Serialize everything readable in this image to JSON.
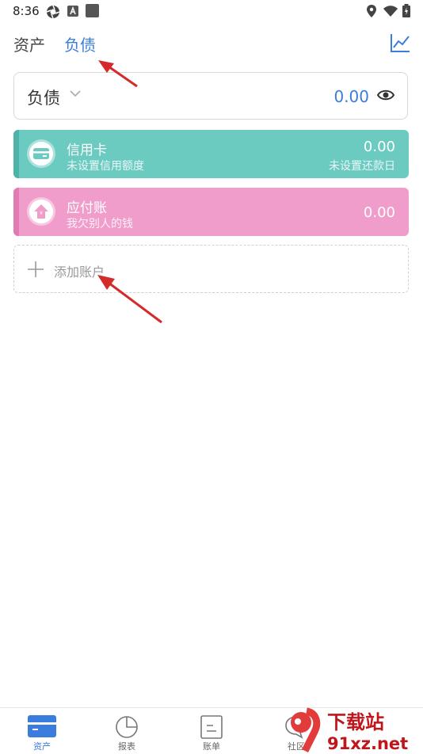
{
  "status_bar": {
    "time": "8:36"
  },
  "tabs": [
    {
      "label": "资产",
      "active": false
    },
    {
      "label": "负债",
      "active": true
    }
  ],
  "summary": {
    "title": "负债",
    "amount": "0.00"
  },
  "accounts": [
    {
      "name": "信用卡",
      "subtitle": "未设置信用额度",
      "amount": "0.00",
      "subtitle_right": "未设置还款日",
      "color": "#6ccbc1",
      "stripe": "#4db3a8",
      "icon": "credit-card-icon"
    },
    {
      "name": "应付账",
      "subtitle": "我欠别人的钱",
      "amount": "0.00",
      "color": "#f09dcc",
      "stripe": "#e27ab3",
      "icon": "payable-house-icon"
    }
  ],
  "add_account": {
    "label": "添加账户"
  },
  "bottom_nav": [
    {
      "label": "资产",
      "active": true,
      "icon": "wallet-icon"
    },
    {
      "label": "报表",
      "active": false,
      "icon": "pie-chart-icon"
    },
    {
      "label": "账单",
      "active": false,
      "icon": "bill-icon"
    },
    {
      "label": "社区",
      "active": false,
      "icon": "chat-icon"
    }
  ],
  "watermark": {
    "text_top": "下载站",
    "text_bottom": "91xz.net"
  },
  "colors": {
    "accent": "#3b7ddd",
    "arrow": "#d42a2a"
  }
}
